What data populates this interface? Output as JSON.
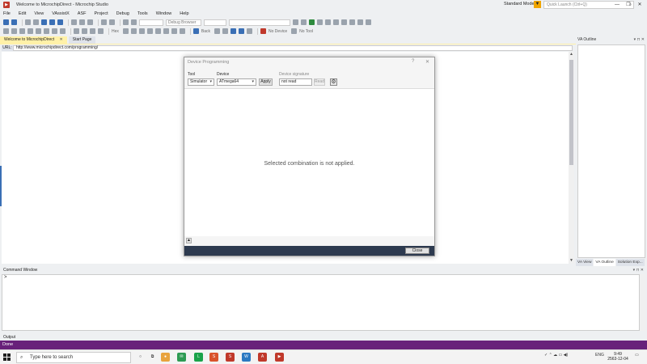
{
  "window": {
    "title": "Welcome to MicrochipDirect - Microchip Studio",
    "mode": "Standard Mode",
    "quick_launch_placeholder": "Quick Launch (Ctrl+Q)",
    "controls": [
      "—",
      "❐",
      "✕"
    ]
  },
  "menu": [
    "File",
    "Edit",
    "View",
    "VAssistX",
    "ASF",
    "Project",
    "Debug",
    "Tools",
    "Window",
    "Help"
  ],
  "toolbar": {
    "debug_browser": "Debug Browser",
    "hex_label": "Hex",
    "back_label": "Back",
    "no_device": "No Device",
    "no_tool": "No Tool"
  },
  "doc_tabs": {
    "active": "Welcome to MicrochipDirect",
    "inactive": "Start Page",
    "close_glyph": "✕"
  },
  "url_bar": {
    "label": "URL:",
    "value": "http://www.microchipdirect.com/programming/"
  },
  "va_outline": {
    "title": "VA Outline",
    "tabs": [
      "VA View",
      "VA Outline",
      "Solution Exp..."
    ]
  },
  "dialog": {
    "title": "Device Programming",
    "help_glyph": "?",
    "close_glyph": "✕",
    "tool_label": "Tool",
    "tool_value": "Simulator",
    "device_label": "Device",
    "device_value": "ATmega64",
    "apply_label": "Apply",
    "signature_label": "Device signature",
    "signature_value": "not read",
    "read_label": "Read",
    "message": "Selected combination is not applied.",
    "close_button": "Close",
    "expand_glyph": "▲"
  },
  "command_window": {
    "title": "Command Window",
    "prompt": ">"
  },
  "output_label": "Output",
  "status": "Done",
  "taskbar": {
    "search_placeholder": "Type here to search",
    "lang": "ENG",
    "time": "9:49",
    "date": "2563-12-04"
  }
}
